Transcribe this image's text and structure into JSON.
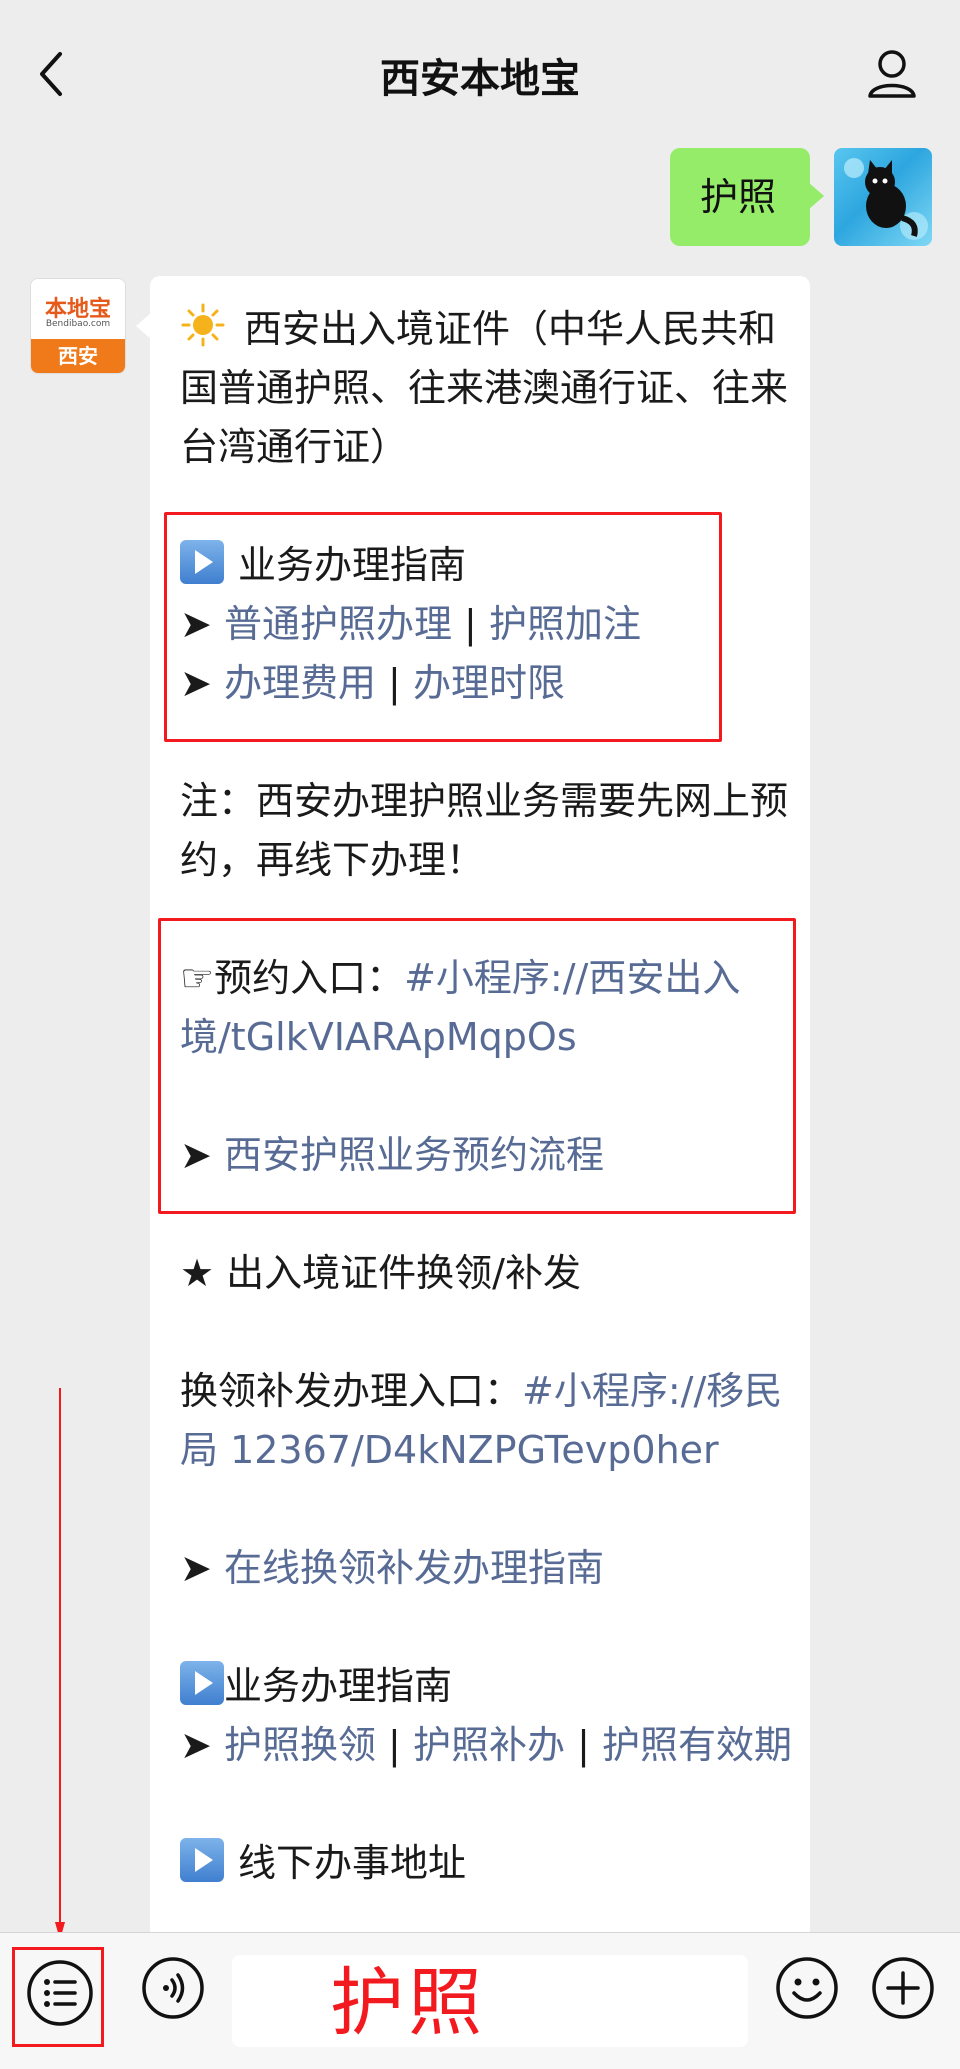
{
  "header": {
    "title": "西安本地宝",
    "back_icon": "chevron-left-icon",
    "profile_icon": "person-icon"
  },
  "outgoing": {
    "text": "护照"
  },
  "brand": {
    "name": "本地宝",
    "domain": "Bendibao.com",
    "city": "西安"
  },
  "message": {
    "intro": "西安出入境证件（中华人民共和国普通护照、往来港澳通行证、往来台湾通行证）",
    "section1_title": "业务办理指南",
    "arrow": "➤",
    "link_ordinary_passport": "普通护照办理",
    "sep": "|",
    "link_passport_endorse": "护照加注",
    "link_fees": "办理费用",
    "link_time_limit": "办理时限",
    "note": "注：西安办理护照业务需要先网上预约，再线下办理！",
    "appointment_pointer": "☞",
    "appointment_label": "预约入口：",
    "appointment_link": "#小程序://西安出入境/tGlkVIARApMqpOs",
    "appointment_process_link": "西安护照业务预约流程",
    "star": "★",
    "renew_title": "出入境证件换领/补发",
    "renew_entry_label": "换领补发办理入口：",
    "renew_entry_link": "#小程序://移民局 12367/D4kNZPGTevp0her",
    "renew_online_link": "在线换领补发办理指南",
    "section2_title": "业务办理指南",
    "link_renew_passport": "护照换领",
    "link_reissue_passport": "护照补办",
    "link_validity": "护照有效期",
    "section3_title": "线下办事地址"
  },
  "bottom_bar": {
    "input_value": "护照",
    "menu_icon": "menu-list-icon",
    "voice_icon": "voice-icon",
    "emoji_icon": "emoji-icon",
    "plus_icon": "plus-icon"
  },
  "colors": {
    "background": "#ededed",
    "outgoing_bubble": "#95ec69",
    "link": "#576b95",
    "annotation_red": "#f2191f",
    "brand_orange": "#f07a1a"
  }
}
